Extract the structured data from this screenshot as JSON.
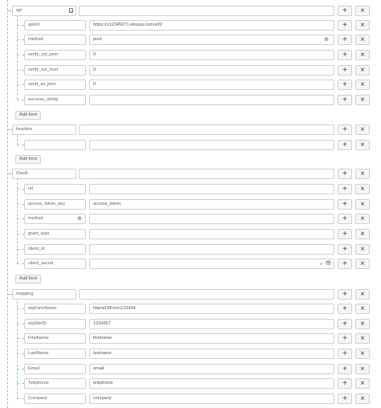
{
  "add_item_label": "Add Item",
  "plus_symbol": "+",
  "times_symbol": "×",
  "api": {
    "key": "api",
    "rows": [
      {
        "key": "apiUrl",
        "value": "https://s12345671.eloqua.com/e/f2"
      },
      {
        "key": "method",
        "value": "post"
      },
      {
        "key": "verify_ssl_peer",
        "value": "0"
      },
      {
        "key": "verify_ssl_host",
        "value": "0"
      },
      {
        "key": "send_as_json",
        "value": "0"
      },
      {
        "key": "success_string",
        "value": ""
      }
    ]
  },
  "headers": {
    "key": "headers",
    "rows": [
      {
        "key": "",
        "value": ""
      }
    ]
  },
  "oauth": {
    "key": "Oauth",
    "rows": [
      {
        "key": "url",
        "value": ""
      },
      {
        "key": "access_token_key",
        "value": "access_token"
      },
      {
        "key": "method",
        "value": ""
      },
      {
        "key": "grant_type",
        "value": ""
      },
      {
        "key": "client_id",
        "value": ""
      },
      {
        "key": "client_secret",
        "value": ""
      }
    ]
  },
  "mapping": {
    "key": "mapping",
    "rows": [
      {
        "key": "elqFormName",
        "value": "NameOfForm123434"
      },
      {
        "key": "elqSiteID",
        "value": "1234567"
      },
      {
        "key": "FirstName",
        "value": "firstname"
      },
      {
        "key": "LastName",
        "value": "lastname"
      },
      {
        "key": "Email",
        "value": "email"
      },
      {
        "key": "Telephone",
        "value": "telephone"
      },
      {
        "key": "Company",
        "value": "company"
      }
    ]
  }
}
